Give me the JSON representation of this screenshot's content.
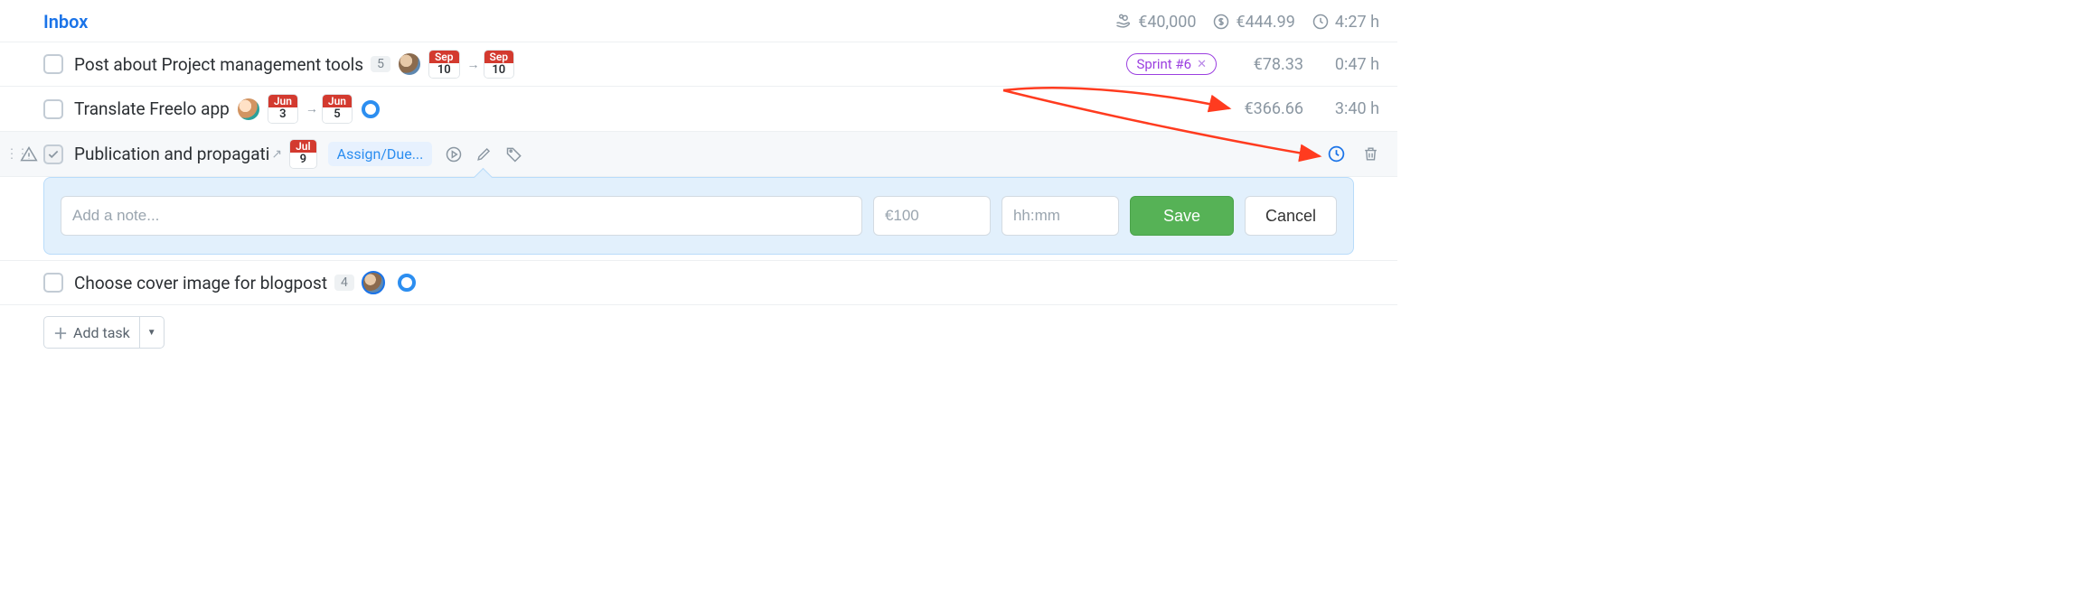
{
  "header": {
    "title": "Inbox",
    "budget": "€40,000",
    "spent": "€444.99",
    "duration": "4:27 h"
  },
  "tasks": [
    {
      "title": "Post about Project management tools",
      "count": "5",
      "date_from_month": "Sep",
      "date_from_day": "10",
      "date_to_month": "Sep",
      "date_to_day": "10",
      "sprint": "Sprint #6",
      "amount": "€78.33",
      "duration": "0:47 h"
    },
    {
      "title": "Translate Freelo app",
      "date_from_month": "Jun",
      "date_from_day": "3",
      "date_to_month": "Jun",
      "date_to_day": "5",
      "amount": "€366.66",
      "duration": "3:40 h"
    },
    {
      "title": "Publication and propagati",
      "date_from_month": "Jul",
      "date_from_day": "9",
      "assign_label": "Assign/Due..."
    },
    {
      "title": "Choose cover image for blogpost",
      "count": "4"
    }
  ],
  "editor": {
    "note_placeholder": "Add a note...",
    "amount_placeholder": "€100",
    "time_placeholder": "hh:mm",
    "save_label": "Save",
    "cancel_label": "Cancel"
  },
  "footer": {
    "add_task_label": "Add task"
  },
  "colors": {
    "accent_blue": "#1a73e8",
    "purple": "#9b3fe0",
    "green": "#56b256",
    "red": "#d33a2f",
    "annotation": "#ff3b1f"
  }
}
